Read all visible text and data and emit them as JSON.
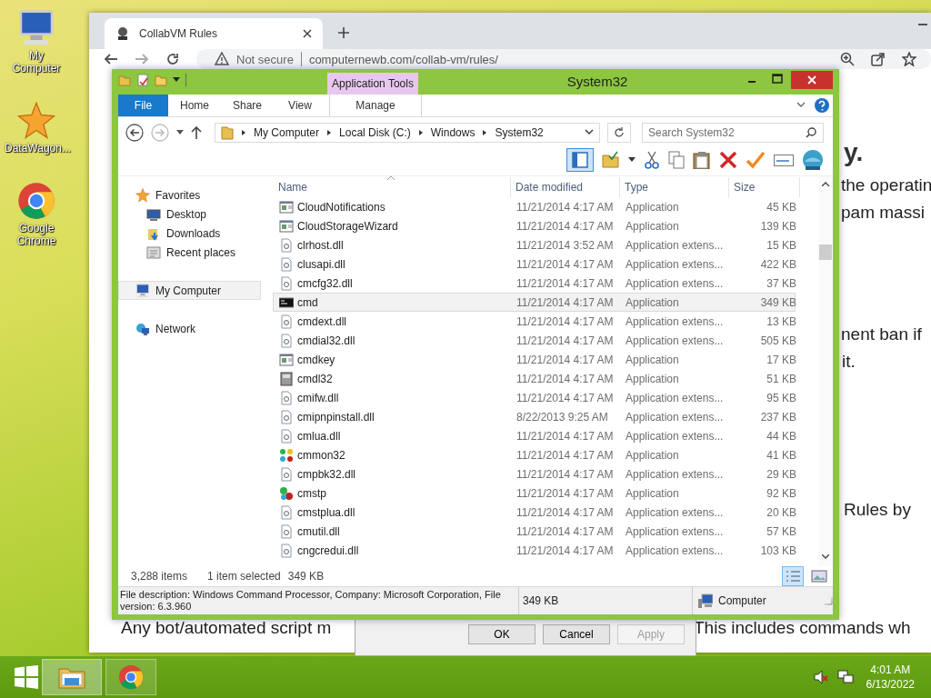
{
  "desktop": {
    "icons": [
      {
        "label": "My Computer",
        "kind": "computer"
      },
      {
        "label": "DataWagon...",
        "kind": "star"
      },
      {
        "label": "Google Chrome",
        "kind": "chrome"
      }
    ]
  },
  "browser": {
    "tab_title": "CollabVM Rules",
    "security": "Not secure",
    "url": "computernewb.com/collab-vm/rules/",
    "page_fragments": [
      {
        "text": "y.",
        "kind": "heading"
      },
      {
        "text": "the operatin",
        "kind": "line"
      },
      {
        "text": "pam massi",
        "kind": "line"
      },
      {
        "text": "nent ban if",
        "kind": "line"
      },
      {
        "text": "it.",
        "kind": "line"
      },
      {
        "text": "Rules by",
        "kind": "line"
      },
      {
        "text": "Any bot/automated script m",
        "kind": "line"
      },
      {
        "text": "This includes commands wh",
        "kind": "line"
      }
    ]
  },
  "dialog": {
    "buttons": [
      {
        "label": "OK",
        "disabled": false
      },
      {
        "label": "Cancel",
        "disabled": false
      },
      {
        "label": "Apply",
        "disabled": true
      }
    ]
  },
  "explorer": {
    "title": "System32",
    "context_label": "Application Tools",
    "ribbon_tabs": [
      {
        "label": "File",
        "kind": "file"
      },
      {
        "label": "Home",
        "kind": "tab"
      },
      {
        "label": "Share",
        "kind": "tab"
      },
      {
        "label": "View",
        "kind": "tab"
      },
      {
        "label": "Manage",
        "kind": "context"
      }
    ],
    "breadcrumb": [
      "My Computer",
      "Local Disk (C:)",
      "Windows",
      "System32"
    ],
    "search": {
      "placeholder": "Search System32"
    },
    "nav": [
      {
        "label": "Favorites",
        "kind": "star",
        "selected": false,
        "children": [
          {
            "label": "Desktop",
            "kind": "desktop",
            "selected": false
          },
          {
            "label": "Downloads",
            "kind": "downloads",
            "selected": false
          },
          {
            "label": "Recent places",
            "kind": "recent",
            "selected": false
          }
        ]
      },
      {
        "label": "My Computer",
        "kind": "computer",
        "selected": true
      },
      {
        "label": "Network",
        "kind": "network",
        "selected": false
      }
    ],
    "columns": [
      "Name",
      "Date modified",
      "Type",
      "Size"
    ],
    "rows": [
      {
        "name": "CloudNotifications",
        "date": "11/21/2014 4:17 AM",
        "type": "Application",
        "size": "45 KB",
        "kind": "exe",
        "selected": false
      },
      {
        "name": "CloudStorageWizard",
        "date": "11/21/2014 4:17 AM",
        "type": "Application",
        "size": "139 KB",
        "kind": "exe",
        "selected": false
      },
      {
        "name": "clrhost.dll",
        "date": "11/21/2014 3:52 AM",
        "type": "Application extens...",
        "size": "15 KB",
        "kind": "dll",
        "selected": false
      },
      {
        "name": "clusapi.dll",
        "date": "11/21/2014 4:17 AM",
        "type": "Application extens...",
        "size": "422 KB",
        "kind": "dll",
        "selected": false
      },
      {
        "name": "cmcfg32.dll",
        "date": "11/21/2014 4:17 AM",
        "type": "Application extens...",
        "size": "37 KB",
        "kind": "dll",
        "selected": false
      },
      {
        "name": "cmd",
        "date": "11/21/2014 4:17 AM",
        "type": "Application",
        "size": "349 KB",
        "kind": "console",
        "selected": true
      },
      {
        "name": "cmdext.dll",
        "date": "11/21/2014 4:17 AM",
        "type": "Application extens...",
        "size": "13 KB",
        "kind": "dll",
        "selected": false
      },
      {
        "name": "cmdial32.dll",
        "date": "11/21/2014 4:17 AM",
        "type": "Application extens...",
        "size": "505 KB",
        "kind": "dll",
        "selected": false
      },
      {
        "name": "cmdkey",
        "date": "11/21/2014 4:17 AM",
        "type": "Application",
        "size": "17 KB",
        "kind": "exe",
        "selected": false
      },
      {
        "name": "cmdl32",
        "date": "11/21/2014 4:17 AM",
        "type": "Application",
        "size": "51 KB",
        "kind": "phone",
        "selected": false
      },
      {
        "name": "cmifw.dll",
        "date": "11/21/2014 4:17 AM",
        "type": "Application extens...",
        "size": "95 KB",
        "kind": "dll",
        "selected": false
      },
      {
        "name": "cmipnpinstall.dll",
        "date": "8/22/2013 9:25 AM",
        "type": "Application extens...",
        "size": "237 KB",
        "kind": "dll",
        "selected": false
      },
      {
        "name": "cmlua.dll",
        "date": "11/21/2014 4:17 AM",
        "type": "Application extens...",
        "size": "44 KB",
        "kind": "dll",
        "selected": false
      },
      {
        "name": "cmmon32",
        "date": "11/21/2014 4:17 AM",
        "type": "Application",
        "size": "41 KB",
        "kind": "knot",
        "selected": false
      },
      {
        "name": "cmpbk32.dll",
        "date": "11/21/2014 4:17 AM",
        "type": "Application extens...",
        "size": "29 KB",
        "kind": "dll",
        "selected": false
      },
      {
        "name": "cmstp",
        "date": "11/21/2014 4:17 AM",
        "type": "Application",
        "size": "92 KB",
        "kind": "knot2",
        "selected": false
      },
      {
        "name": "cmstplua.dll",
        "date": "11/21/2014 4:17 AM",
        "type": "Application extens...",
        "size": "20 KB",
        "kind": "dll",
        "selected": false
      },
      {
        "name": "cmutil.dll",
        "date": "11/21/2014 4:17 AM",
        "type": "Application extens...",
        "size": "57 KB",
        "kind": "dll",
        "selected": false
      },
      {
        "name": "cngcredui.dll",
        "date": "11/21/2014 4:17 AM",
        "type": "Application extens...",
        "size": "103 KB",
        "kind": "dll",
        "selected": false
      }
    ],
    "item_count": "3,288 items",
    "selection": "1 item selected",
    "selection_size": "349 KB",
    "details": {
      "description": "File description: Windows Command Processor, Company: Microsoft Corporation, File version: 6.3.960",
      "size": "349 KB",
      "location": "Computer"
    }
  },
  "taskbar": {
    "apps": [
      {
        "kind": "explorer"
      },
      {
        "kind": "chrome"
      }
    ],
    "time": "4:01 AM",
    "date": "6/13/2022"
  }
}
